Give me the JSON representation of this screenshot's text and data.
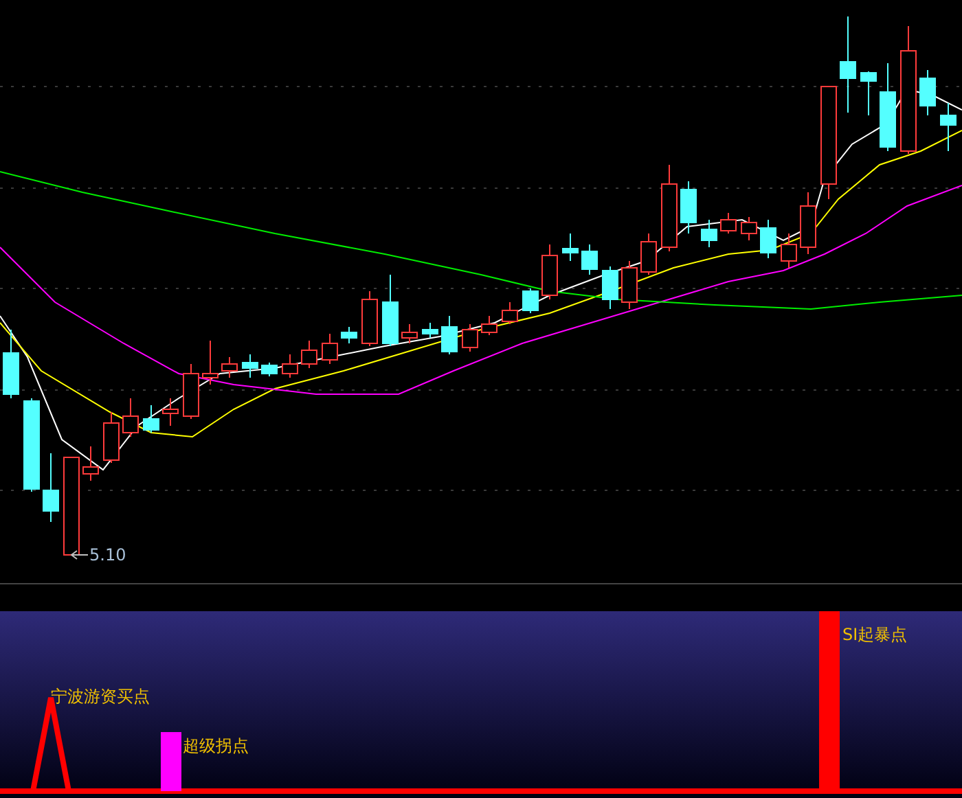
{
  "price_chart": {
    "low_label": "5.10"
  },
  "signal_panel": {
    "signals": [
      {
        "kind": "spike",
        "color": "#ff0000",
        "label": "宁波游资买点"
      },
      {
        "kind": "bar",
        "color": "#ff00ff",
        "label": "超级拐点"
      },
      {
        "kind": "bar",
        "color": "#ff0000",
        "label": "SI起暴点"
      }
    ]
  }
}
